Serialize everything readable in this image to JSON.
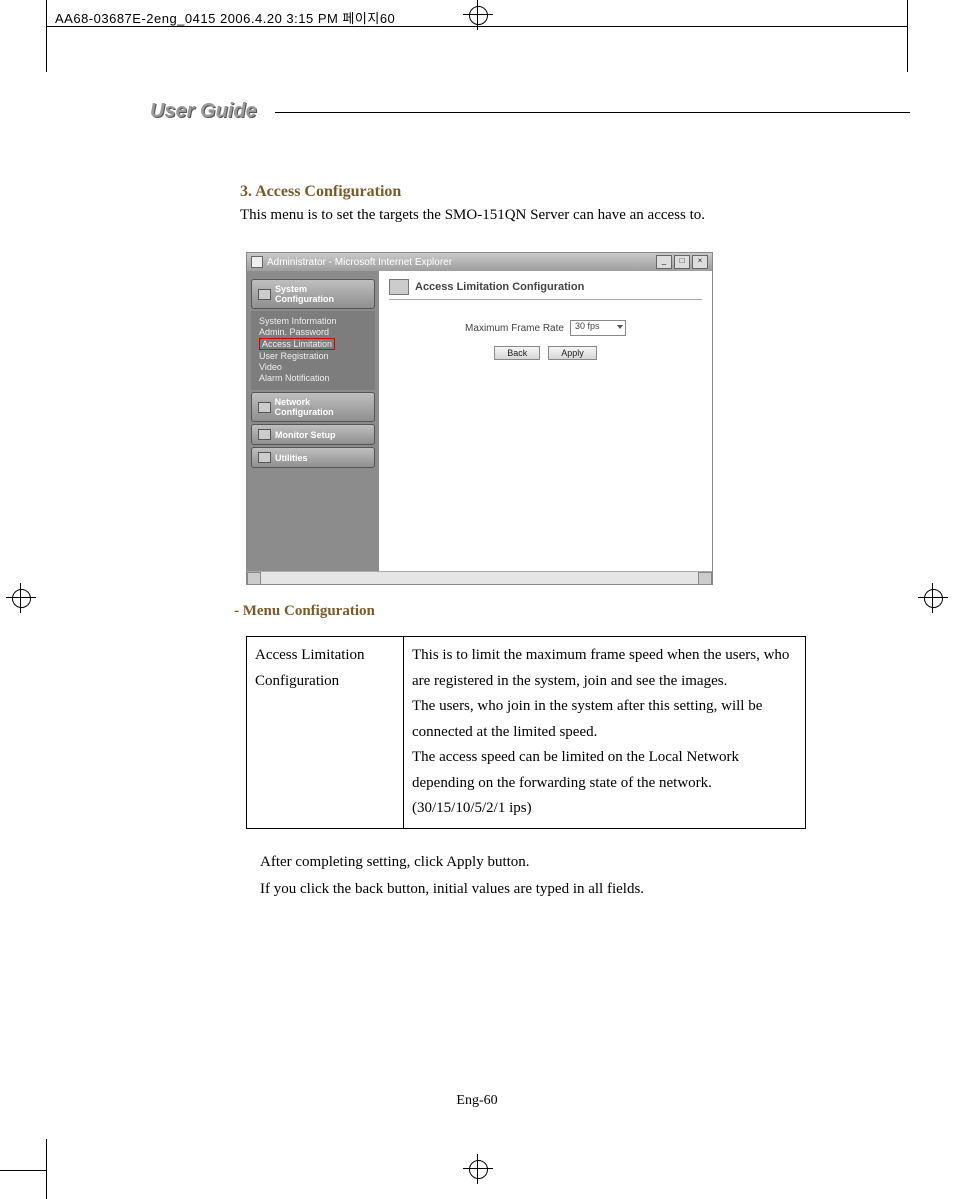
{
  "print_header": "AA68-03687E-2eng_0415  2006.4.20 3:15 PM  페이지60",
  "running_head": "User Guide",
  "section_title": "3. Access Configuration",
  "intro_text": "This menu is to set the targets the SMO-151QN Server can have an access to.",
  "window": {
    "title": "Administrator - Microsoft Internet Explorer",
    "minimize": "_",
    "maximize": "□",
    "close": "×",
    "sidebar": {
      "system_config": "System Configuration",
      "items": {
        "system_information": "System Information",
        "admin_password": "Admin. Password",
        "access_limitation": "Access Limitation",
        "user_registration": "User Registration",
        "video": "Video",
        "alarm_notification": "Alarm Notification"
      },
      "network_config": "Network Configuration",
      "monitor_setup": "Monitor Setup",
      "utilities": "Utilities"
    },
    "panel": {
      "heading": "Access Limitation Configuration",
      "field_label": "Maximum Frame Rate",
      "field_value": "30 fps",
      "back": "Back",
      "apply": "Apply"
    }
  },
  "menu_config_title": "- Menu Configuration",
  "table": {
    "left": "Access Limitation Configuration",
    "right": "This is to limit the maximum frame speed when the users, who are registered in the system, join and see the images.\nThe users, who join in the system after this setting, will be connected at the limited speed.\nThe access speed can be limited on the Local Network depending on the forwarding state of the network. (30/15/10/5/2/1 ips)"
  },
  "after_1": "After completing setting, click Apply button.",
  "after_2": "If you click the back button, initial values are typed in all fields.",
  "page_number": "Eng-60"
}
